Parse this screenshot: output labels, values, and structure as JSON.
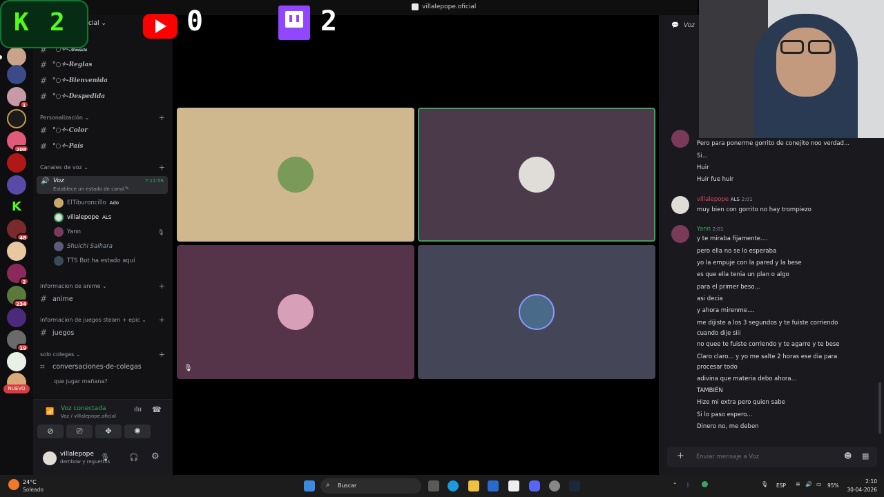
{
  "window": {
    "title": "villalepope.oficial",
    "server_name_partial": "cial"
  },
  "overlay": {
    "kick_count": "2",
    "youtube_count": "0",
    "twitch_count": "2"
  },
  "rail": {
    "badges": [
      "1",
      "208",
      "48",
      "2",
      "234",
      "19"
    ],
    "new_label": "NUEVO"
  },
  "sidebar": {
    "channels_top": [
      {
        "name": "°○✧-𝒜𝓋𝒾𝓈𝑜𝓈"
      },
      {
        "name": "°○✧-Reglas"
      },
      {
        "name": "°○✧-Bienvenida"
      },
      {
        "name": "°○✧-Despedida"
      }
    ],
    "category_personalizacion": "Personalización",
    "channels_personal": [
      {
        "name": "°○✧-Color"
      },
      {
        "name": "°○✧-País"
      }
    ],
    "category_voz": "Canales de voz",
    "voice_channel": {
      "name": "Voz",
      "timer": "7:11:58",
      "status": "Establece un estado de canal"
    },
    "members": [
      {
        "name": "ElTiburoncillo",
        "tag": "Ado"
      },
      {
        "name": "villalepope",
        "tag": "ALS"
      },
      {
        "name": "Yann",
        "tag": ""
      },
      {
        "name": "Shuichi Saihara",
        "tag": ""
      },
      {
        "name": "TTS Bot ha estado aquí",
        "tag": ""
      }
    ],
    "category_anime": "informacion de anime",
    "channel_anime": "anime",
    "category_juegos": "informacion de juegos steam + epic",
    "channel_juegos": "juegos",
    "category_colegas": "solo colegas",
    "channel_colegas": "conversaciones-de-colegas",
    "thread_colegas": "que jugar mañana?"
  },
  "voice_panel": {
    "status": "Voz conectada",
    "location": "Voz / villalepope.oficial"
  },
  "user_panel": {
    "username": "villalepope",
    "status": "dembow y reguettos"
  },
  "chat": {
    "header_channel": "Voz",
    "messages": [
      {
        "text": "Pero para ponerme gorrito de conejito noo verdad..."
      },
      {
        "text": "Si..."
      },
      {
        "text": "Huir"
      },
      {
        "text": "Huir fue huir"
      }
    ],
    "group2": {
      "author": "villalepope",
      "tag": "ALS",
      "time": "2:01",
      "text": "muy bien con gorrito no hay trompiezo"
    },
    "group3": {
      "author": "Yann",
      "time": "2:01",
      "lines": [
        "y te miraba fijamente....",
        "pero ella no se lo esperaba",
        "yo la empuje con la pared y la bese",
        "es que ella tenia un plan o algo",
        "para el primer beso...",
        "asi decia",
        "y ahora mirenme....",
        "me dijiste a los 3 segundos y te fuiste corriendo",
        "cuando dije siii",
        "no quee te fuiste corriendo y te agarre y te bese",
        "Claro claro... y yo me salte 2 horas ese dia para",
        "procesar todo",
        "adivina que materia debo ahora...",
        "TAMBIÉN",
        "Hize mi extra pero quien sabe",
        "Si lo paso espero...",
        "Dinero no, me deben"
      ]
    },
    "input_placeholder": "Enviar mensaje a Voz"
  },
  "taskbar": {
    "weather_temp": "24°C",
    "weather_desc": "Soleado",
    "search_label": "Buscar",
    "lang": "ESP",
    "battery": "95%",
    "time": "2:10",
    "date": "30-04-2026"
  },
  "colors": {
    "tile1": "#cfb88e",
    "tile2": "#4a3a4a",
    "tile3": "#553348",
    "tile4": "#454558",
    "speaking": "#3ba55d",
    "kick_green": "#53fc18"
  }
}
